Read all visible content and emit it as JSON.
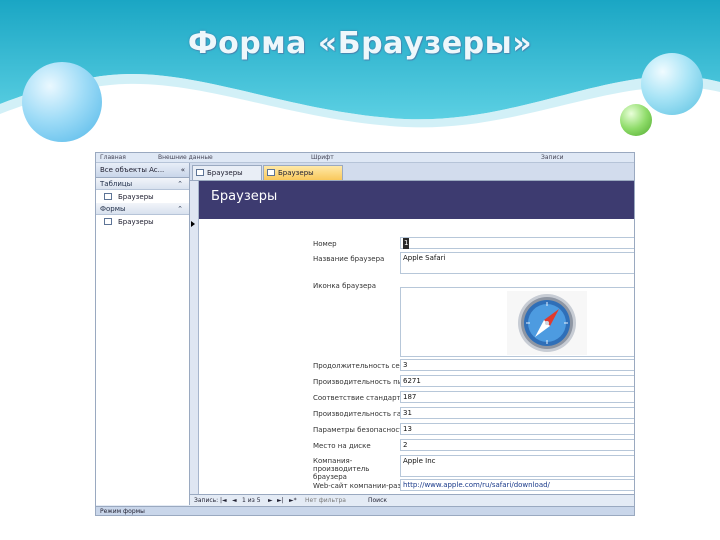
{
  "slide": {
    "title": "Форма «Браузеры»"
  },
  "colors": {
    "header_teal": "#29b6cf",
    "form_header": "#3d3b70",
    "active_tab": "#f9c85c"
  },
  "ribbon": {
    "items": [
      "Главная",
      "Внешние данные",
      "Шрифт",
      "Записи"
    ]
  },
  "nav": {
    "header": "Все объекты Ac...",
    "groups": [
      {
        "label": "Таблицы",
        "items": [
          "Браузеры"
        ]
      },
      {
        "label": "Формы",
        "items": [
          "Браузеры"
        ]
      }
    ]
  },
  "tabs": [
    {
      "label": "Браузеры",
      "active": false
    },
    {
      "label": "Браузеры",
      "active": true
    }
  ],
  "form": {
    "title": "Браузеры",
    "fields": [
      {
        "label": "Номер",
        "value": "1"
      },
      {
        "label": "Название браузера",
        "value": "Apple Safari"
      },
      {
        "label": "Иконка браузера",
        "value": ""
      },
      {
        "label": "Продолжительность сей",
        "value": "3"
      },
      {
        "label": "Производительность пи",
        "value": "6271"
      },
      {
        "label": "Соответствие стандарту",
        "value": "187"
      },
      {
        "label": "Производительность гаj",
        "value": "31"
      },
      {
        "label": "Параметры безопасности",
        "value": "13"
      },
      {
        "label": "Место на диске",
        "value": "2"
      },
      {
        "label": "Компания-производитель браузера",
        "value": "Apple Inc"
      },
      {
        "label": "Web-сайт компании-разр",
        "value": "http://www.apple.com/ru/safari/download/"
      }
    ],
    "icon_image": "safari-compass-icon"
  },
  "record_nav": {
    "label": "Запись:",
    "position": "1 из 5",
    "filter": "Нет фильтра",
    "search": "Поиск"
  },
  "status_bar": {
    "text": "Режим формы"
  }
}
